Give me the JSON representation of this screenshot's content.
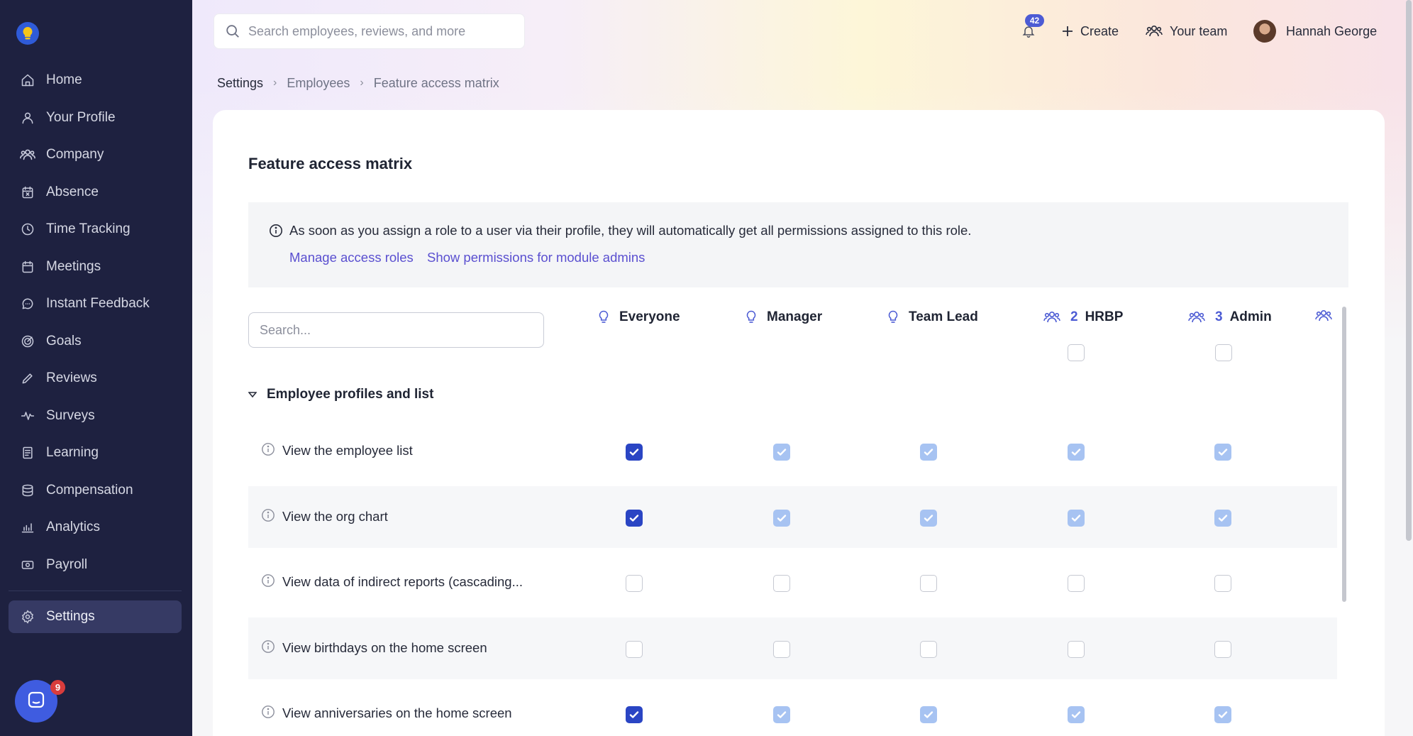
{
  "sidebar": {
    "items": [
      {
        "label": "Home",
        "icon": "home-icon"
      },
      {
        "label": "Your Profile",
        "icon": "user-icon"
      },
      {
        "label": "Company",
        "icon": "users-icon"
      },
      {
        "label": "Absence",
        "icon": "calendar-x-icon"
      },
      {
        "label": "Time Tracking",
        "icon": "clock-icon"
      },
      {
        "label": "Meetings",
        "icon": "calendar-icon"
      },
      {
        "label": "Instant Feedback",
        "icon": "chat-icon"
      },
      {
        "label": "Goals",
        "icon": "target-icon"
      },
      {
        "label": "Reviews",
        "icon": "pencil-icon"
      },
      {
        "label": "Surveys",
        "icon": "pulse-icon"
      },
      {
        "label": "Learning",
        "icon": "book-icon"
      },
      {
        "label": "Compensation",
        "icon": "coins-icon"
      },
      {
        "label": "Analytics",
        "icon": "chart-icon"
      },
      {
        "label": "Payroll",
        "icon": "money-icon"
      }
    ],
    "settings_label": "Settings",
    "chat_badge": "9"
  },
  "header": {
    "search_placeholder": "Search employees, reviews, and more",
    "notifications_count": "42",
    "create_label": "Create",
    "team_label": "Your team",
    "user_name": "Hannah George"
  },
  "breadcrumb": [
    "Settings",
    "Employees",
    "Feature access matrix"
  ],
  "page": {
    "title": "Feature access matrix",
    "info_text": "As soon as you assign a role to a user via their profile, they will automatically get all permissions assigned to this role.",
    "link_manage": "Manage access roles",
    "link_show": "Show permissions for module admins",
    "search_placeholder": "Search..."
  },
  "columns": [
    {
      "name": "Everyone",
      "count": "",
      "icon": "bulb-icon"
    },
    {
      "name": "Manager",
      "count": "",
      "icon": "bulb-icon"
    },
    {
      "name": "Team Lead",
      "count": "",
      "icon": "bulb-icon"
    },
    {
      "name": "HRBP",
      "count": "2",
      "icon": "users-icon"
    },
    {
      "name": "Admin",
      "count": "3",
      "icon": "users-icon"
    }
  ],
  "section": {
    "title": "Employee profiles and list",
    "rows": [
      {
        "label": "View the employee list",
        "values": [
          "on",
          "inherit",
          "inherit",
          "inherit",
          "inherit"
        ]
      },
      {
        "label": "View the org chart",
        "values": [
          "on",
          "inherit",
          "inherit",
          "inherit",
          "inherit"
        ]
      },
      {
        "label": "View data of indirect reports (cascading...",
        "values": [
          "empty",
          "empty",
          "empty",
          "empty",
          "empty"
        ]
      },
      {
        "label": "View birthdays on the home screen",
        "values": [
          "empty",
          "empty",
          "empty",
          "empty",
          "empty"
        ]
      },
      {
        "label": "View anniversaries on the home screen",
        "values": [
          "on",
          "inherit",
          "inherit",
          "inherit",
          "inherit"
        ]
      }
    ]
  },
  "colors": {
    "sidebar_bg": "#1e2140",
    "accent": "#4c5bd4",
    "checkbox_on": "#2a45c4",
    "checkbox_inherit": "#a7c3f2"
  }
}
